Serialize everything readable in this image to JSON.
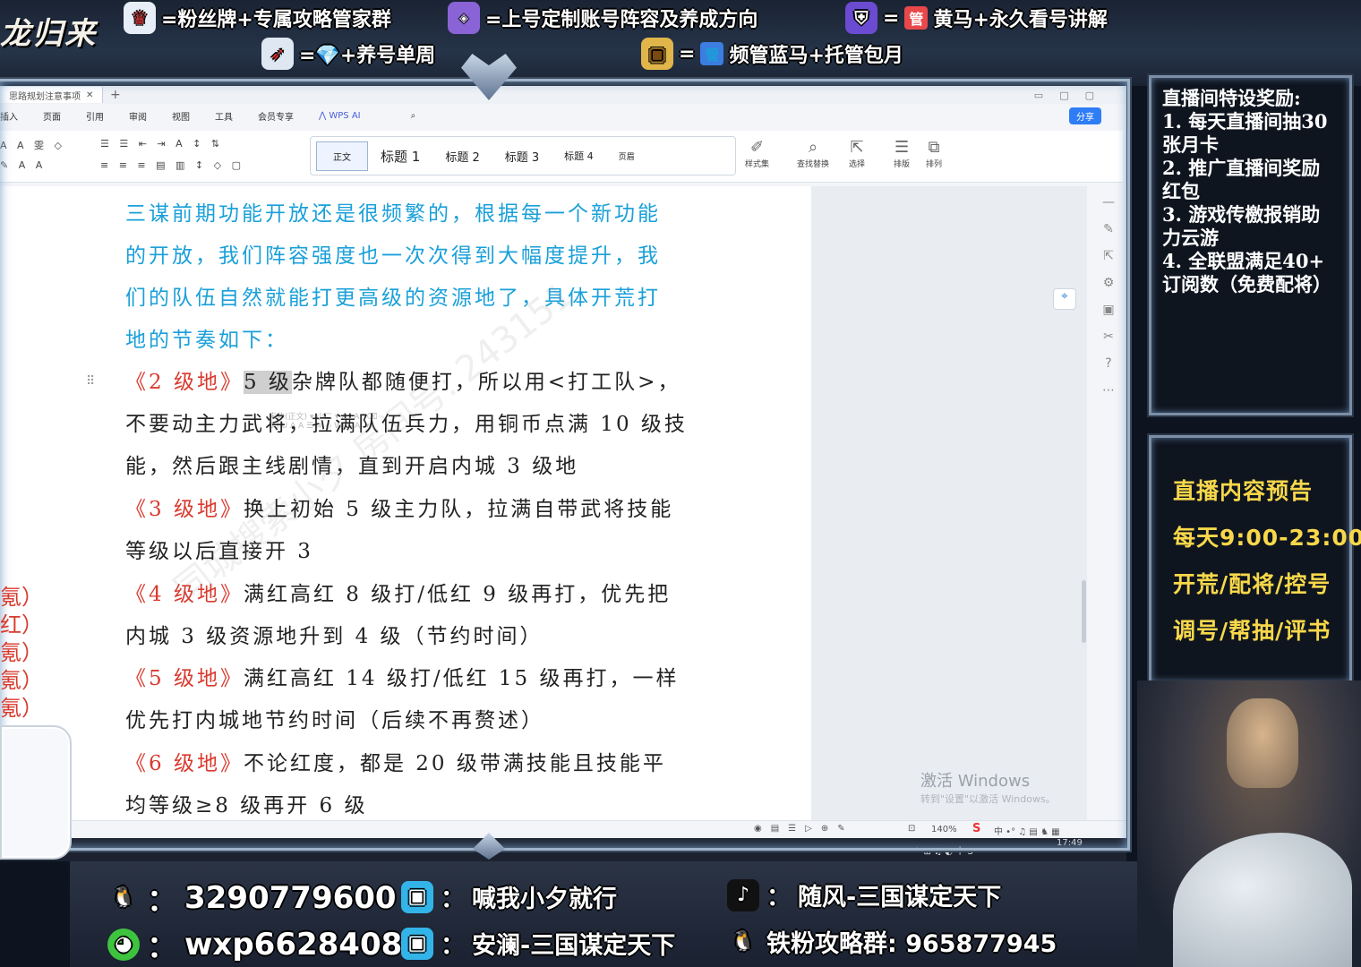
{
  "overlay": {
    "brand": "龙归来",
    "banners": [
      {
        "icon": "chef-hat-icon",
        "text": "=粉丝牌+专属攻略管家群"
      },
      {
        "icon": "daily-badge-icon",
        "text": "=上号定制账号阵容及养成方向"
      },
      {
        "icon": "guard-shield-icon",
        "text": "=",
        "tag": "管",
        "text2": "黄马+永久看号讲解"
      },
      {
        "icon": "rocket-icon",
        "text": "=💎+养号单周"
      },
      {
        "icon": "treasure-chest-icon",
        "text": "=",
        "tag": "管",
        "text2": "频管蓝马+托管包月"
      }
    ]
  },
  "wps": {
    "doc_tab": "思路规划注意事项",
    "menu": [
      "插入",
      "页面",
      "引用",
      "审阅",
      "视图",
      "工具",
      "会员专享"
    ],
    "wps_ai": "WPS AI",
    "share": "分享",
    "styles": [
      "正文",
      "标题 1",
      "标题 2",
      "标题 3",
      "标题 4",
      "页眉"
    ],
    "tools": [
      {
        "icon": "style-set-icon",
        "label": "样式集"
      },
      {
        "icon": "find-replace-icon",
        "label": "查找替换"
      },
      {
        "icon": "select-icon",
        "label": "选择"
      },
      {
        "icon": "layout-icon",
        "label": "排版"
      },
      {
        "icon": "arrange-icon",
        "label": "排列"
      }
    ],
    "zoom": "140%",
    "clock": "17:49",
    "activate_title": "激活 Windows",
    "activate_sub": "转到\"设置\"以激活 Windows。"
  },
  "doc": {
    "intro": [
      "三谋前期功能开放还是很频繁的，根据每一个新功能",
      "的开放，我们阵容强度也一次次得到大幅度提升，我",
      "们的队伍自然就能打更高级的资源地了，具体开荒打",
      "地的节奏如下："
    ],
    "l2_head": "《2 级地》",
    "l2_hl": "5 级",
    "l2_rest": "杂牌队都随便打，所以用<打工队>，",
    "l2_lines": [
      "不要动主力武将，拉满队伍兵力，用铜币点满 10 级技",
      "能，然后跟主线剧情，直到开启内城 3 级地"
    ],
    "l3_head": "《3 级地》",
    "l3_rest": "换上初始 5 级主力队，拉满自带武将技能",
    "l3_line": "等级以后直接开 3",
    "l4_head": "《4 级地》",
    "l4_rest": "满红高红 8 级打/低红 9 级再打，优先把",
    "l4_line": "内城 3 级资源地升到 4 级（节约时间）",
    "l5_head": "《5 级地》",
    "l5_rest": "满红高红 14 级打/低红 15 级再打，一样",
    "l5_line": "优先打内城地节约时间（后续不再赘述）",
    "l6_head": "《6 级地》",
    "l6_rest": "不论红度，都是 20 级带满技能且技能平",
    "l6_line": "均等级≥8 级再开 6 级",
    "watermark": "同城搜索小夕 房间号: 243151",
    "edge_chars": [
      "氪）",
      "红）",
      "氪）",
      "氪）",
      "氪）"
    ]
  },
  "panel1": {
    "lines": [
      "直播间特设奖励:",
      "1. 每天直播间抽30",
      "张月卡",
      "2. 推广直播间奖励",
      "红包",
      "3. 游戏传檄报销助",
      "力云游",
      "4. 全联盟满足40+",
      "订阅数（免费配将）"
    ]
  },
  "panel2": {
    "items": [
      "直播内容预告",
      "每天9:00-23:00",
      "开荒/配将/控号",
      "调号/帮抽/评书"
    ]
  },
  "contacts": [
    {
      "icon": "qq-penguin-icon",
      "sep": "：",
      "text": "3290779600"
    },
    {
      "icon": "bilibili-tv-icon",
      "sep": "：",
      "text": "喊我小夕就行"
    },
    {
      "icon": "tiktok-note-icon",
      "sep": "：",
      "text": "随风-三国谋定天下"
    },
    {
      "icon": "wechat-icon",
      "sep": "：",
      "text": "wxp66284089"
    },
    {
      "icon": "bilibili-tv-icon",
      "sep": "：",
      "text": "安澜-三国谋定天下"
    },
    {
      "icon": "qq-penguin-icon",
      "sep": "",
      "text": "铁粉攻略群: 965877945"
    }
  ],
  "colors": {
    "accent_blue": "#1aa0d9",
    "heading_red": "#d93a2e",
    "promo_yellow": "#f8d84a"
  }
}
